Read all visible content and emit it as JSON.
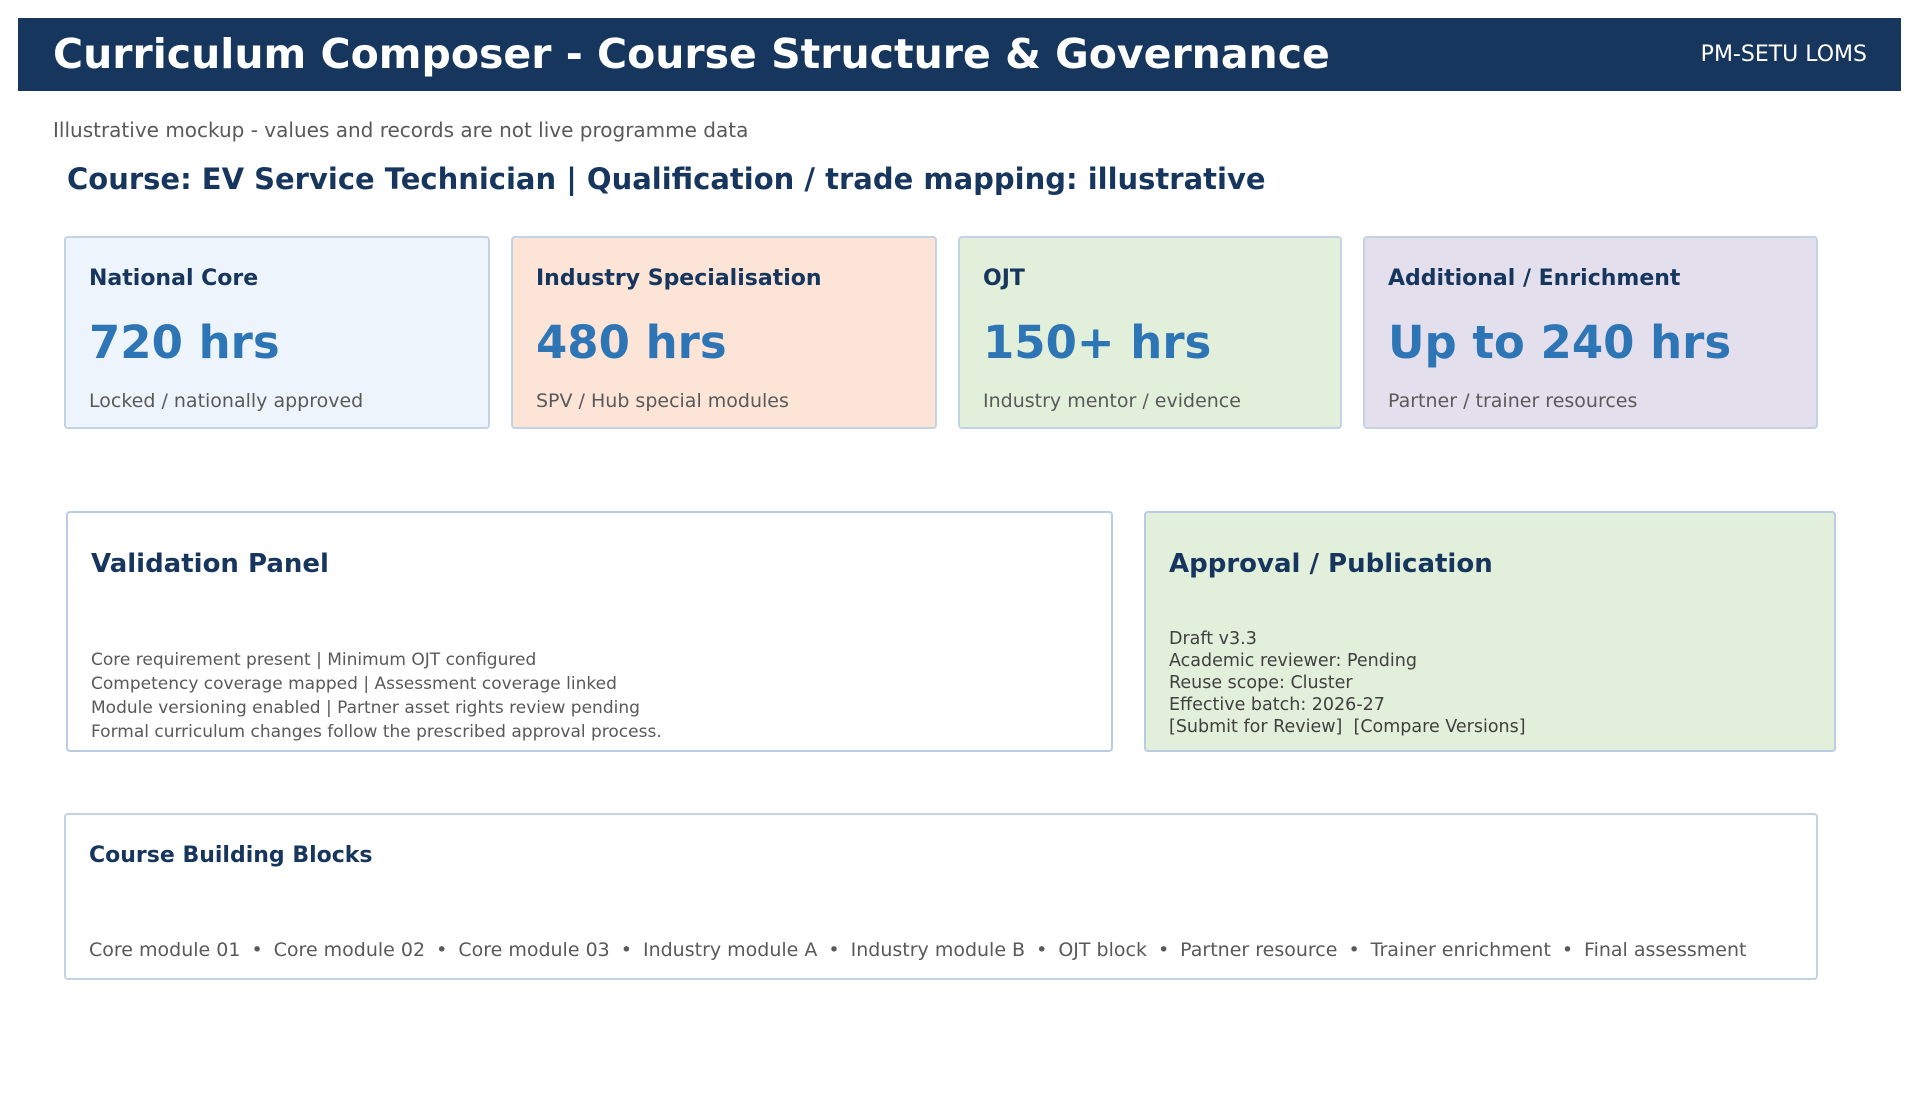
{
  "header": {
    "title": "Curriculum Composer - Course Structure & Governance",
    "app_name": "PM-SETU LOMS"
  },
  "disclaimer": "Illustrative mockup - values and records are not live programme data",
  "course_line": "Course: EV Service Technician  |  Qualification / trade mapping: illustrative",
  "cards": [
    {
      "title": "National Core",
      "value": "720 hrs",
      "note": "Locked / nationally approved",
      "color": "#edf4fb"
    },
    {
      "title": "Industry Specialisation",
      "value": "480 hrs",
      "note": "SPV / Hub special modules",
      "color": "#fce4d7"
    },
    {
      "title": "OJT",
      "value": "150+ hrs",
      "note": "Industry mentor / evidence",
      "color": "#e2efda"
    },
    {
      "title": "Additional / Enrichment",
      "value": "Up to 240 hrs",
      "note": "Partner / trainer resources",
      "color": "#e4dfed"
    }
  ],
  "validation": {
    "title": "Validation Panel",
    "lines": [
      "Core requirement present  |  Minimum OJT configured",
      "Competency coverage mapped  |  Assessment coverage linked",
      "Module versioning enabled  |  Partner asset rights review pending",
      "Formal curriculum changes follow the prescribed approval process."
    ]
  },
  "approval": {
    "title": "Approval / Publication",
    "lines": [
      "Draft v3.3",
      "Academic reviewer: Pending",
      "Reuse scope: Cluster",
      "Effective batch: 2026-27"
    ],
    "submit_label": "[Submit for Review]",
    "compare_label": "[Compare Versions]"
  },
  "building_blocks": {
    "title": "Course Building Blocks",
    "separator": "•",
    "items": [
      "Core module 01",
      "Core module 02",
      "Core module 03",
      "Industry module A",
      "Industry module B",
      "OJT block",
      "Partner resource",
      "Trainer enrichment",
      "Final assessment"
    ]
  },
  "colors": {
    "header_bg": "#17365d",
    "accent_value": "#2e75b6",
    "approval_bg": "#e2efda"
  }
}
